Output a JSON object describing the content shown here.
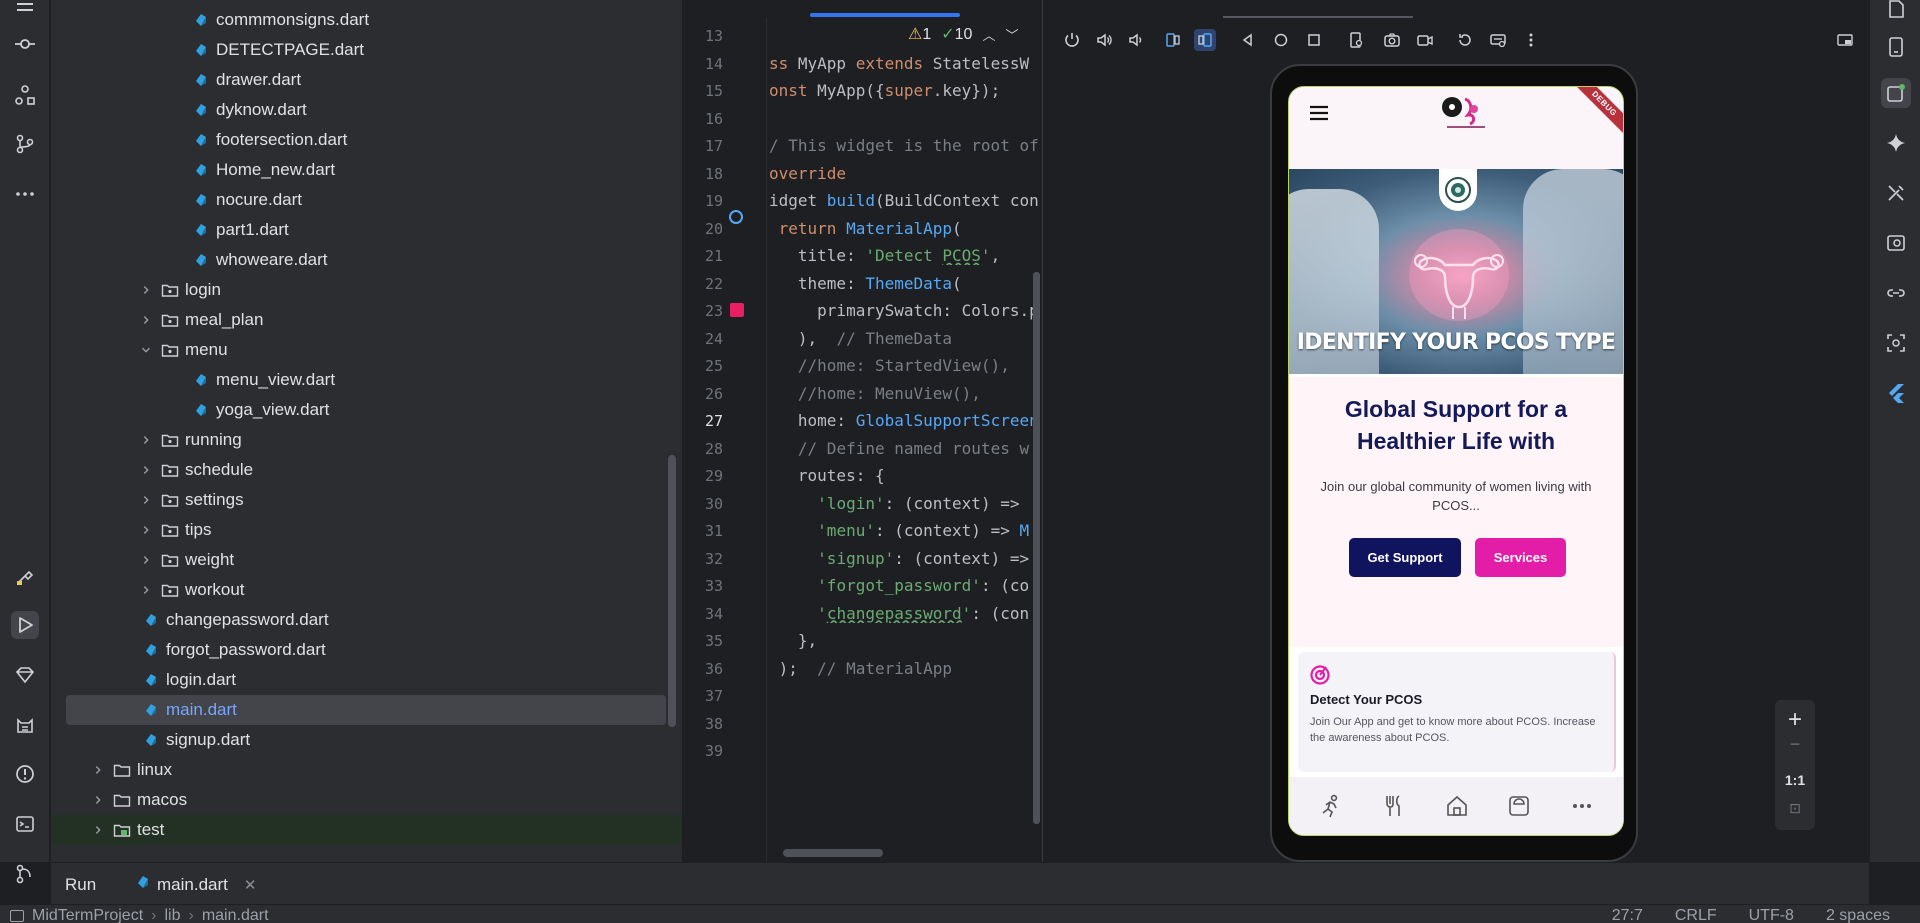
{
  "project_tree": {
    "items": [
      {
        "label": "commmonsigns.dart"
      },
      {
        "label": "DETECTPAGE.dart"
      },
      {
        "label": "drawer.dart"
      },
      {
        "label": "dyknow.dart"
      },
      {
        "label": "footersection.dart"
      },
      {
        "label": "Home_new.dart"
      },
      {
        "label": "nocure.dart"
      },
      {
        "label": "part1.dart"
      },
      {
        "label": "whoweare.dart"
      },
      {
        "label": "login"
      },
      {
        "label": "meal_plan"
      },
      {
        "label": "menu"
      },
      {
        "label": "menu_view.dart"
      },
      {
        "label": "yoga_view.dart"
      },
      {
        "label": "running"
      },
      {
        "label": "schedule"
      },
      {
        "label": "settings"
      },
      {
        "label": "tips"
      },
      {
        "label": "weight"
      },
      {
        "label": "workout"
      },
      {
        "label": "changepassword.dart"
      },
      {
        "label": "forgot_password.dart"
      },
      {
        "label": "login.dart"
      },
      {
        "label": "main.dart"
      },
      {
        "label": "signup.dart"
      },
      {
        "label": "linux"
      },
      {
        "label": "macos"
      },
      {
        "label": "test"
      }
    ]
  },
  "editor": {
    "inspections": {
      "warnings": "1",
      "weak": "10"
    },
    "lines": [
      "13",
      "14",
      "15",
      "16",
      "17",
      "18",
      "19",
      "20",
      "21",
      "22",
      "23",
      "24",
      "25",
      "26",
      "27",
      "28",
      "29",
      "30",
      "31",
      "32",
      "33",
      "34",
      "35",
      "36",
      "37",
      "38",
      "39"
    ]
  },
  "phone": {
    "debug_banner": "DEBUG",
    "hero_title": "IDENTIFY YOUR PCOS TYPE",
    "support_title": "Global Support for a Healthier Life with",
    "support_subtitle": "Join our global community of women living with PCOS...",
    "get_support_label": "Get Support",
    "services_label": "Services",
    "card_title": "Detect Your PCOS",
    "card_body": "Join Our App and get to know more about PCOS. Increase the awareness about PCOS."
  },
  "zoom": {
    "plus": "+",
    "minus": "−",
    "ratio": "1:1"
  },
  "run_bar": {
    "label": "Run",
    "tab": "main.dart"
  },
  "status_bar": {
    "breadcrumb": [
      "MidTermProject",
      "lib",
      "main.dart"
    ],
    "position": "27:7",
    "line_sep": "CRLF",
    "encoding": "UTF-8",
    "indent": "2 spaces"
  },
  "colors": {
    "accent": "#3574f0",
    "brand_navy": "#10135e",
    "brand_pink": "#e31da8"
  }
}
